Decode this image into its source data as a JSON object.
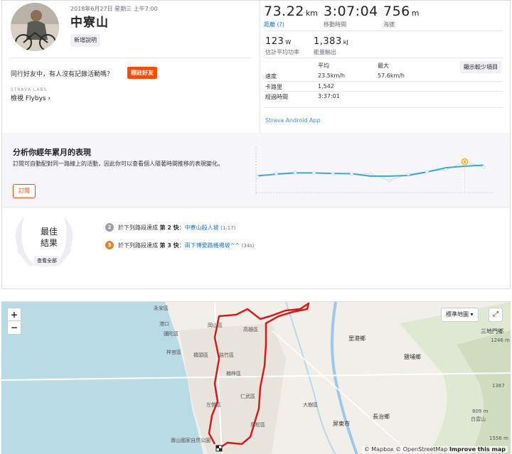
{
  "activity": {
    "date": "2018年6月27日 星期三 上午7:00",
    "title": "中寮山",
    "add_description": "新增說明",
    "friends_prompt": "同行好友中，有人沒有記錄活動嗎？",
    "tag_friends": "標註好友",
    "labs_label": "STRAVA LABS",
    "flybys": "檢視 Flybys ›"
  },
  "stats": {
    "distance": {
      "value": "73.22",
      "unit": "km",
      "label": "距離 (?)"
    },
    "moving_time": {
      "value": "3:07:04",
      "label": "移動時間"
    },
    "elevation": {
      "value": "756",
      "unit": "m",
      "label": "海拔"
    },
    "power": {
      "value": "123",
      "unit": "W",
      "label": "估計平均功率"
    },
    "energy": {
      "value": "1,383",
      "unit": "kJ",
      "label": "能量輸出"
    },
    "table": {
      "col_avg": "平均",
      "col_max": "最大",
      "rows": [
        {
          "label": "速度",
          "avg": "23.5km/h",
          "max": "57.6km/h"
        },
        {
          "label": "卡路里",
          "avg": "1,542",
          "max": ""
        },
        {
          "label": "經過時間",
          "avg": "3:37:01",
          "max": ""
        }
      ]
    },
    "show_less": "顯示較少項目",
    "device": "Strava Android App"
  },
  "analysis": {
    "title": "分析你經年累月的表現",
    "description": "訂閱可自動配對同一路線上的活動，因此你可以查看個人隨著時間推移的表現變化。",
    "subscribe": "訂閱",
    "trend_values": [
      0.32,
      0.42,
      0.45,
      0.43,
      0.42,
      0.4,
      0.41,
      0.22,
      0.4,
      0.46,
      0.52,
      0.75,
      0.6
    ],
    "trend_colors": {
      "line": "#3aa9d6",
      "highlight": "#fcaa1c"
    }
  },
  "best": {
    "title_line1": "最佳",
    "title_line2": "結果",
    "view_all": "查看全部",
    "achievements": [
      {
        "medal": "2",
        "medal_color": "#9e9ea6",
        "prefix": "於下列路段達成",
        "rank": "第 2 快",
        "sep": "：",
        "segment": "中寮山殺人坡",
        "time": "(1:17)"
      },
      {
        "medal": "3",
        "medal_color": "#d9892c",
        "prefix": "於下列路段達成",
        "rank": "第 3 快",
        "sep": "：",
        "segment": "兩下博愛路機場坡^^",
        "time": "(34s)"
      }
    ]
  },
  "map": {
    "zoom_in": "+",
    "zoom_out": "−",
    "map_type": "標準地圖 ▾",
    "fullscreen": "⤢",
    "attribution_prefix": "© Mapbox © OpenStreetMap",
    "attribution_link": "Improve this map",
    "route_color": "#d7191c",
    "labels": {
      "l1": "永安區",
      "l2": "彌陀區",
      "l3": "梓官區",
      "l4": "橋頭區",
      "l5": "燕巢區",
      "l6": "岡山區",
      "l7": "高雄區",
      "l8": "里港鄉",
      "l9": "鹽埔鄉",
      "l10": "三地門鄉",
      "l11": "仁武區",
      "l12": "大樹區",
      "l13": "屏東市",
      "l14": "長治鄉",
      "l15": "鳥松區",
      "l16": "左營區",
      "l17": "壽山國家自然公園",
      "l18": "楠梓區",
      "l19": "路竹區",
      "l20": "1246 m",
      "l21": "1367",
      "l22": "809 m",
      "l23": "1556 m",
      "l24": "港口",
      "l25": "白雲山",
      "l26": "德文山",
      "l27": "鹽埔區"
    }
  }
}
